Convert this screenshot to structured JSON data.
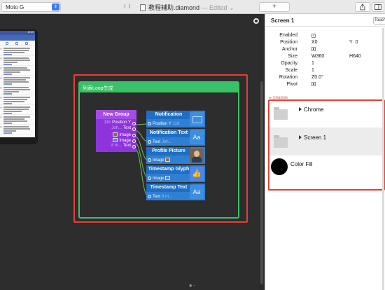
{
  "toolbar": {
    "device": "Moto G",
    "file_name": "教程辅助.diamond",
    "edited": "— Edited",
    "edited_chevron": "⌄",
    "add_label": "+"
  },
  "phone": {
    "time": "12:30"
  },
  "canvas": {
    "loop_title": "列表Loop生成",
    "group_node": {
      "title": "New Group",
      "ports": [
        {
          "label": "Position Y",
          "prefix": "116"
        },
        {
          "label": "Text",
          "prefix": "Joh..."
        },
        {
          "label": "Image",
          "prefix": ""
        },
        {
          "label": "Image",
          "prefix": ""
        },
        {
          "label": "Text",
          "prefix": "8 m..."
        }
      ]
    },
    "layer_nodes": [
      {
        "title": "Notification",
        "port": "Position Y",
        "value": "116",
        "thumb": "folder"
      },
      {
        "title": "Notification Text",
        "port": "Text",
        "value": "Joh...",
        "thumb": "Aa"
      },
      {
        "title": "Profile Picture",
        "port": "Image",
        "value": "",
        "thumb": "photo"
      },
      {
        "title": "Timestamp Glyph",
        "port": "Image",
        "value": "",
        "thumb": "like"
      },
      {
        "title": "Timestamp Text",
        "port": "Text",
        "value": "8 m...",
        "thumb": "Aa"
      }
    ]
  },
  "inspector": {
    "title": "Screen 1",
    "touch_label": "Touch",
    "properties": {
      "enabled_label": "Enabled",
      "position_label": "Position",
      "position_x_axis": "X",
      "position_x": "0",
      "position_y_axis": "Y",
      "position_y": "0",
      "anchor_label": "Anchor",
      "size_label": "Size",
      "size_w_axis": "W",
      "size_w": "360",
      "size_h_axis": "H",
      "size_h": "640",
      "opacity_label": "Opacity",
      "opacity": "1",
      "scale_label": "Scale",
      "scale": "1",
      "rotation_label": "Rotation",
      "rotation_axis": "Z",
      "rotation": "0.0°",
      "pivot_label": "Pivot"
    },
    "shadow_label": "Shadow",
    "layers": [
      {
        "name": "Chrome",
        "icon": "folder-icon",
        "disclosure": true
      },
      {
        "name": "Screen 1",
        "icon": "folder-icon",
        "disclosure": true
      },
      {
        "name": "Color Fill",
        "icon": "fill-circle",
        "disclosure": false
      }
    ]
  },
  "colors": {
    "group_node": "#8e34dd",
    "layer_node": "#2f7fd3",
    "loop_green": "#38c166",
    "highlight_red": "#e24037"
  }
}
